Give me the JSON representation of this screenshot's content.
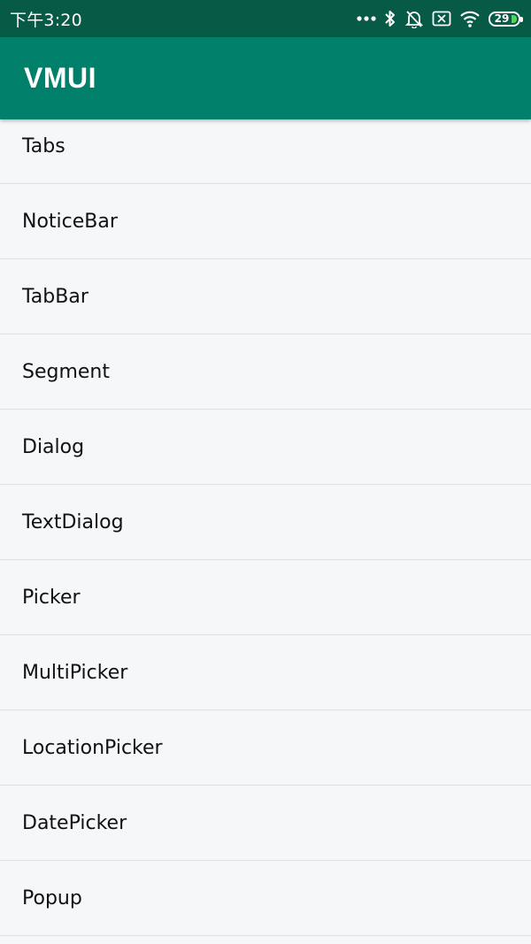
{
  "status_bar": {
    "time": "下午3:20",
    "battery_level": "29",
    "icons": [
      "more-dots-icon",
      "bluetooth-icon",
      "alarm-off-icon",
      "no-sim-icon",
      "wifi-icon",
      "battery-icon"
    ]
  },
  "app_bar": {
    "title": "VMUI"
  },
  "menu": {
    "items": [
      {
        "label": "Tabs"
      },
      {
        "label": "NoticeBar"
      },
      {
        "label": "TabBar"
      },
      {
        "label": "Segment"
      },
      {
        "label": "Dialog"
      },
      {
        "label": "TextDialog"
      },
      {
        "label": "Picker"
      },
      {
        "label": "MultiPicker"
      },
      {
        "label": "LocationPicker"
      },
      {
        "label": "DatePicker"
      },
      {
        "label": "Popup"
      }
    ]
  },
  "colors": {
    "status_bar": "#065a46",
    "app_bar": "#00806a",
    "background": "#f5f7f9",
    "battery_fill": "#55d25a"
  }
}
